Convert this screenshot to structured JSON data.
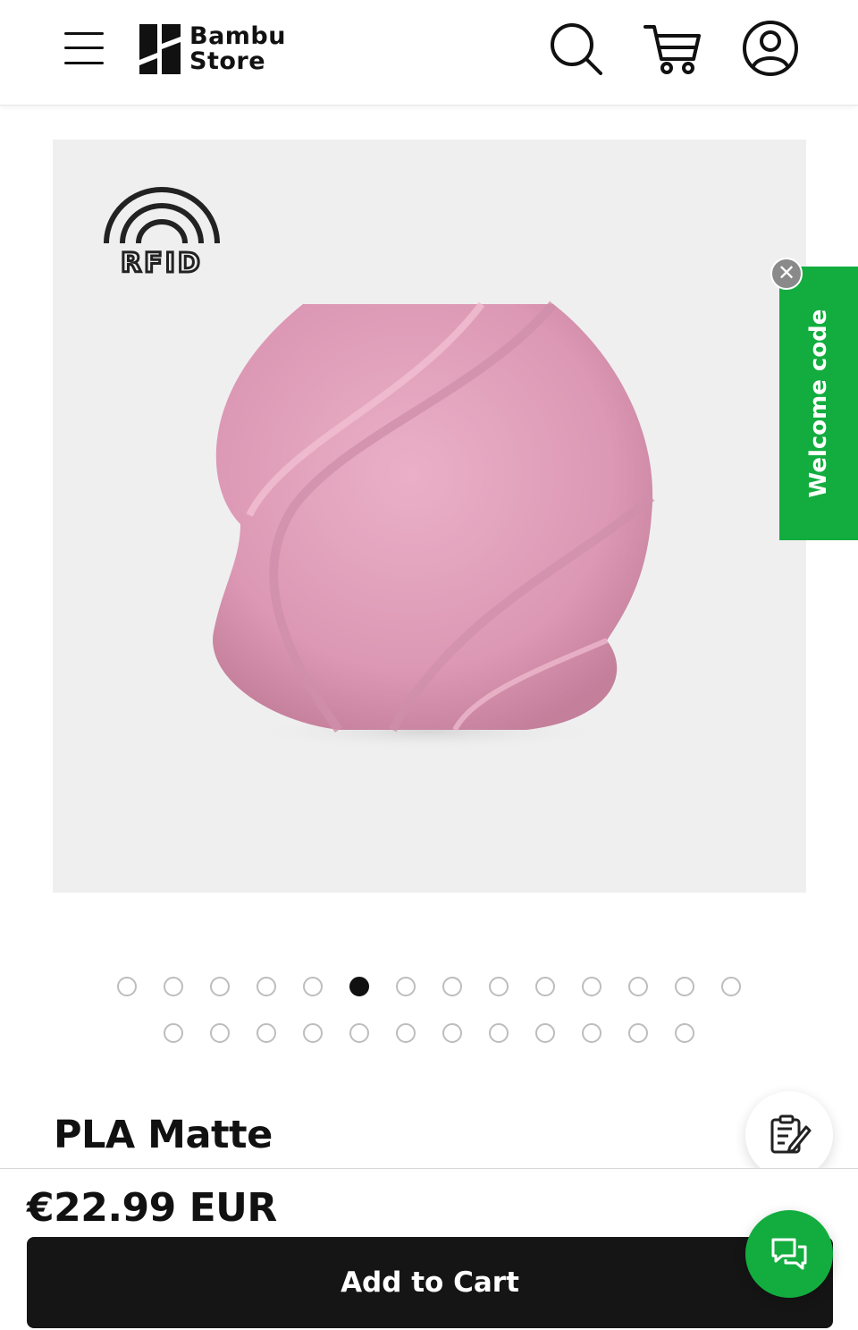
{
  "header": {
    "brand_line1": "Bambu",
    "brand_line2": "Store",
    "icons": [
      "menu-icon",
      "search-icon",
      "cart-icon",
      "account-icon"
    ]
  },
  "product": {
    "badge": "RFID",
    "title": "PLA Matte",
    "price": "€22.99 EUR",
    "add_to_cart_label": "Add to Cart",
    "vase_color": "#e6a6c0"
  },
  "welcome": {
    "label": "Welcome code",
    "close_glyph": "✕"
  },
  "carousel": {
    "row1_count": 14,
    "row2_count": 12,
    "active_index": 5
  },
  "colors": {
    "accent_green": "#13ad3f",
    "button_dark": "#151515",
    "image_bg": "#efefef"
  },
  "floating": {
    "notes_icon": "notes-edit-icon",
    "chat_icon": "chat-bubbles-icon"
  }
}
